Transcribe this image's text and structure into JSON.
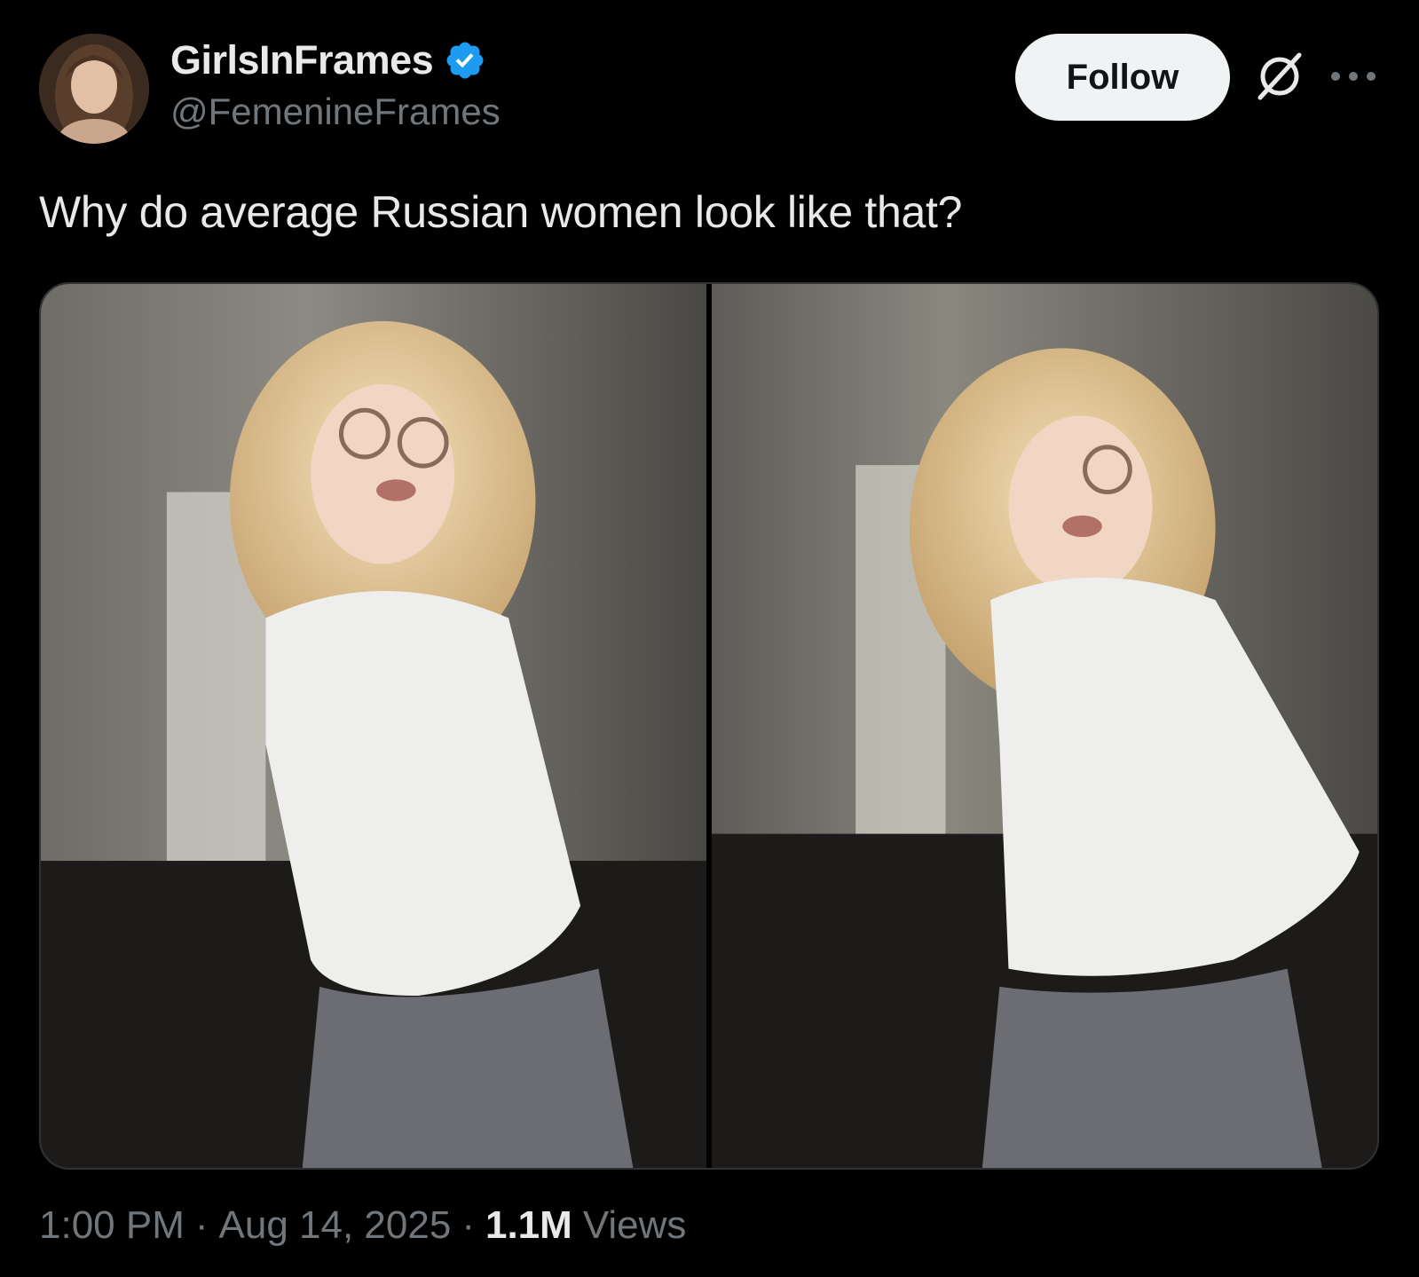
{
  "author": {
    "display_name": "GirlsInFrames",
    "handle": "@FemenineFrames",
    "verified": true,
    "verified_color": "#1d9bf0"
  },
  "actions": {
    "follow_label": "Follow"
  },
  "tweet": {
    "text": "Why do average Russian women look like that?"
  },
  "media": {
    "photos": [
      {
        "icon": "photo"
      },
      {
        "icon": "photo"
      }
    ]
  },
  "meta": {
    "time": "1:00 PM",
    "separator": "·",
    "date": "Aug 14, 2025",
    "views_count": "1.1M",
    "views_label": "Views"
  },
  "colors": {
    "background": "#000000",
    "text_primary": "#e7e9ea",
    "text_secondary": "#71767b",
    "follow_bg": "#eff3f4",
    "border": "#2f3336"
  }
}
